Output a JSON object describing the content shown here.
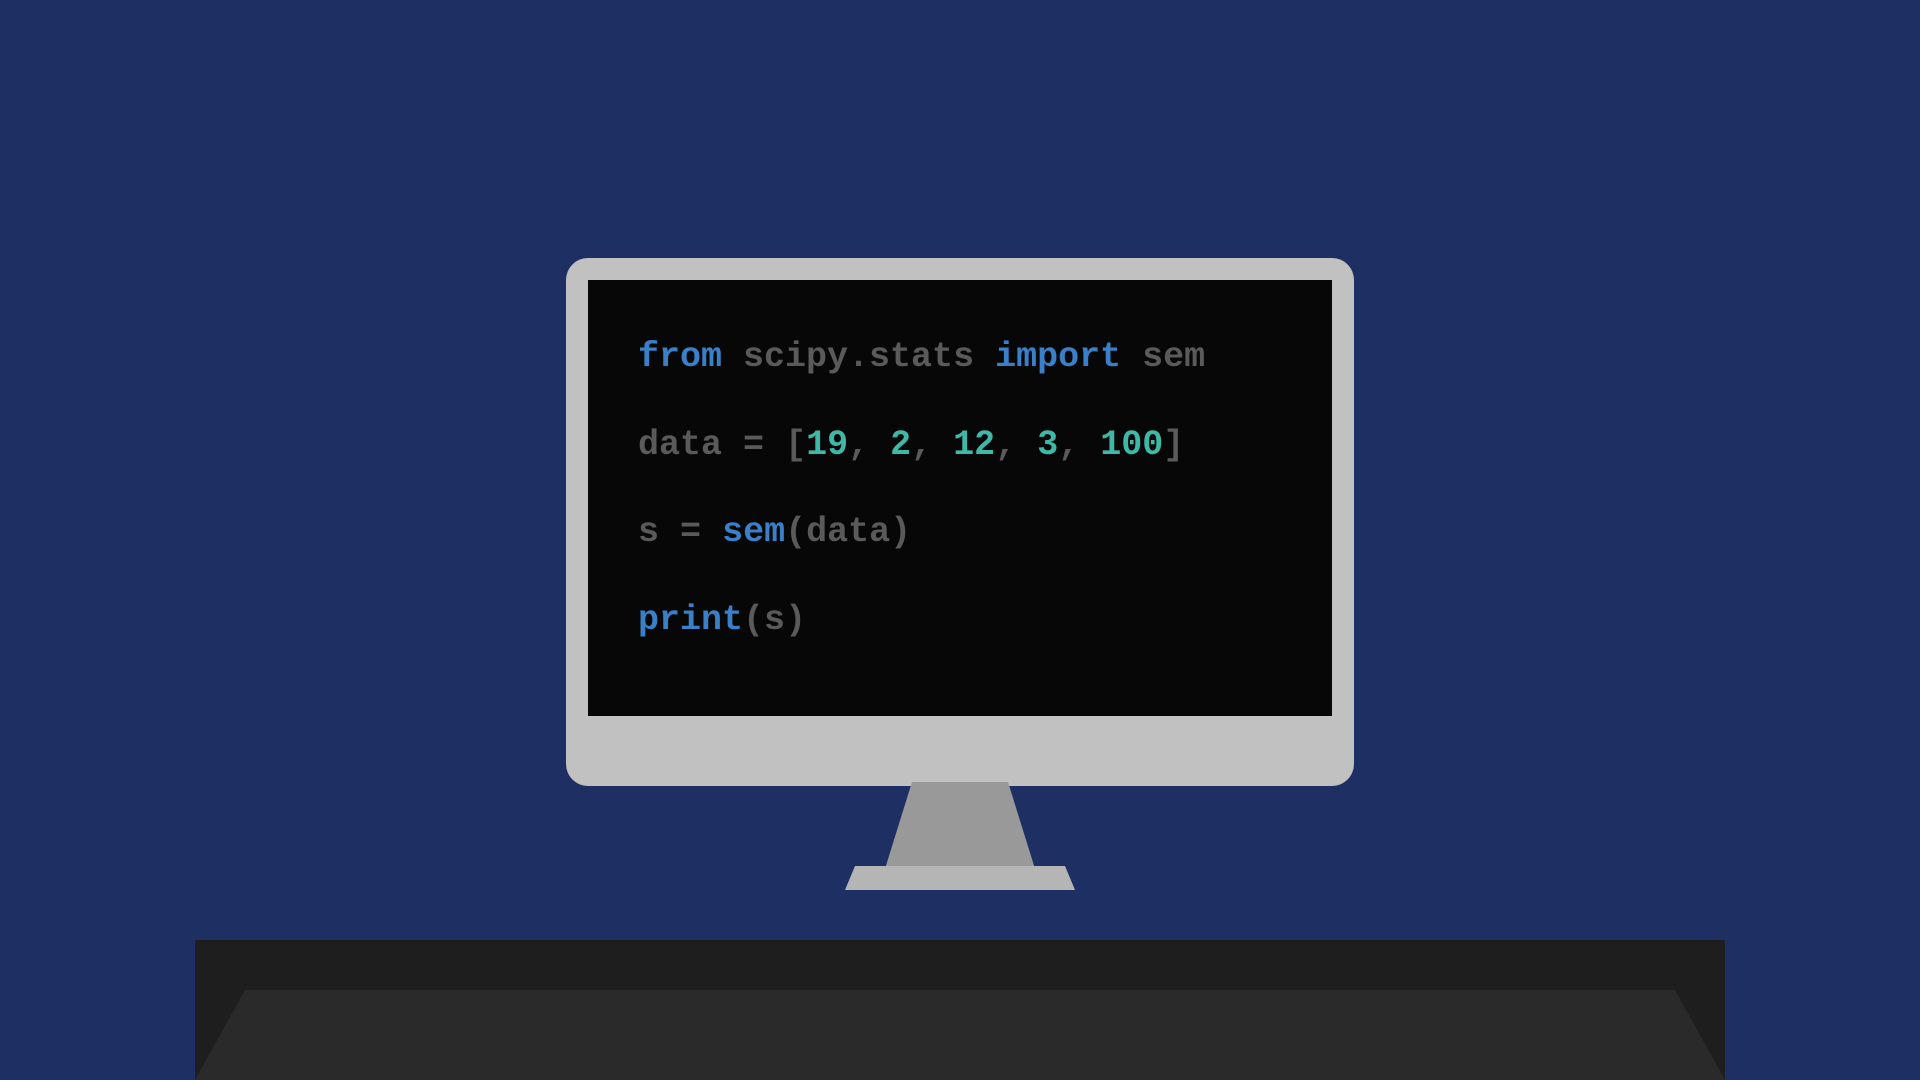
{
  "code": {
    "line1": {
      "from_kw": "from",
      "module": "scipy.stats",
      "import_kw": "import",
      "name": "sem"
    },
    "line2": {
      "var": "data",
      "eq": "=",
      "lb": "[",
      "n1": "19",
      "c1": ",",
      "n2": "2",
      "c2": ",",
      "n3": "12",
      "c3": ",",
      "n4": "3",
      "c4": ",",
      "n5": "100",
      "rb": "]"
    },
    "line3": {
      "var": "s",
      "eq": "=",
      "func": "sem",
      "lp": "(",
      "arg": "data",
      "rp": ")"
    },
    "line4": {
      "func": "print",
      "lp": "(",
      "arg": "s",
      "rp": ")"
    }
  }
}
